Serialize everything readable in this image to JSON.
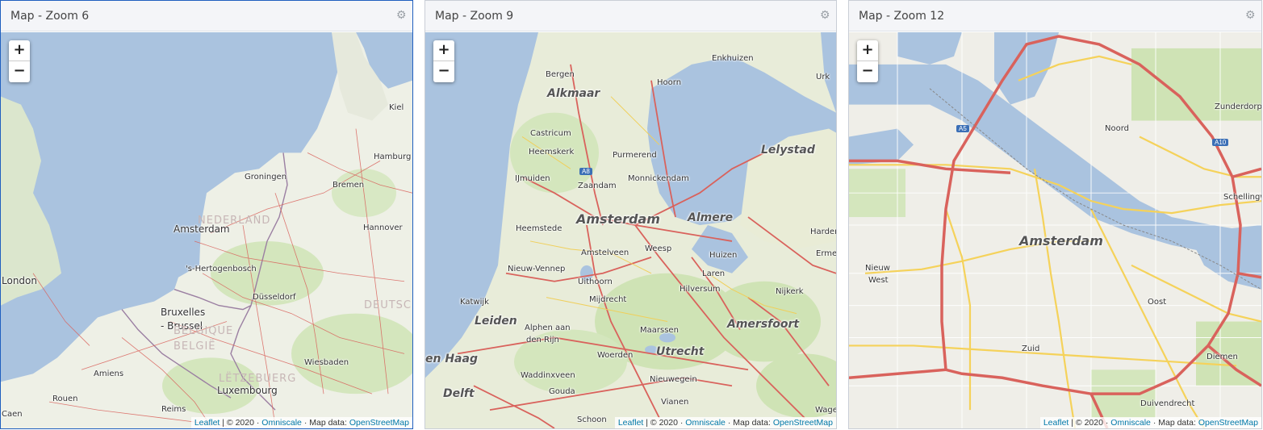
{
  "panels": [
    {
      "title": "Map - Zoom 6",
      "labels": [
        "Kiel",
        "Hamburg",
        "Groningen",
        "Bremen",
        "NEDERLAND",
        "Amsterdam",
        "Hannover",
        "'s-Hertogenbosch",
        "London",
        "Düsseldorf",
        "DEUTSCH",
        "Bruxelles",
        "- Brussel",
        "BELGIQUE",
        "BELGIË",
        "Wiesbaden",
        "Amiens",
        "LËTZEBUERG",
        "Luxembourg",
        "Rouen",
        "Reims",
        "Caen"
      ]
    },
    {
      "title": "Map - Zoom 9",
      "labels": [
        "Enkhuizen",
        "Bergen",
        "Hoorn",
        "Urk",
        "Alkmaar",
        "Castricum",
        "Heemskerk",
        "Purmerend",
        "Lelystad",
        "IJmuiden",
        "Monnickendam",
        "Zaandam",
        "Amsterdam",
        "Almere",
        "Heemstede",
        "Weesp",
        "Harder",
        "Amstelveen",
        "Huizen",
        "Erme",
        "Nieuw-Vennep",
        "Laren",
        "Uithoorn",
        "Hilversum",
        "Nijkerk",
        "Katwijk",
        "Mijdrecht",
        "Leiden",
        "Amersfoort",
        "Alphen aan",
        "den Rijn",
        "Maarssen",
        "Woerden",
        "Utrecht",
        "en Haag",
        "Waddinxveen",
        "Nieuwegein",
        "Gouda",
        "Delft",
        "Vianen",
        "Schoon",
        "Wage"
      ],
      "shields": [
        "A8"
      ]
    },
    {
      "title": "Map - Zoom 12",
      "labels": [
        "Zunderdorp",
        "Noord",
        "Schellingwoude",
        "Amsterdam",
        "Nieuw",
        "West",
        "Oost",
        "Zuid",
        "Diemen",
        "Duivendrecht"
      ],
      "shields": [
        "A5",
        "A10"
      ]
    }
  ],
  "zoom": {
    "in_label": "+",
    "out_label": "−"
  },
  "attribution": {
    "leaflet": "Leaflet",
    "copyright": "| © 2020",
    "provider": "Omniscale",
    "mapdata": "· Map data:",
    "osm": "OpenStreetMap"
  },
  "icons": {
    "settings": "gear-icon"
  },
  "colors": {
    "water": "#aac3df",
    "land": "#eef0e6",
    "green": "#cfe3b5",
    "motorway": "#d9625c",
    "major_road": "#f5d25a",
    "border": "#9b7fa2",
    "panel_header": "#f4f5f8",
    "link": "#0078a8"
  }
}
